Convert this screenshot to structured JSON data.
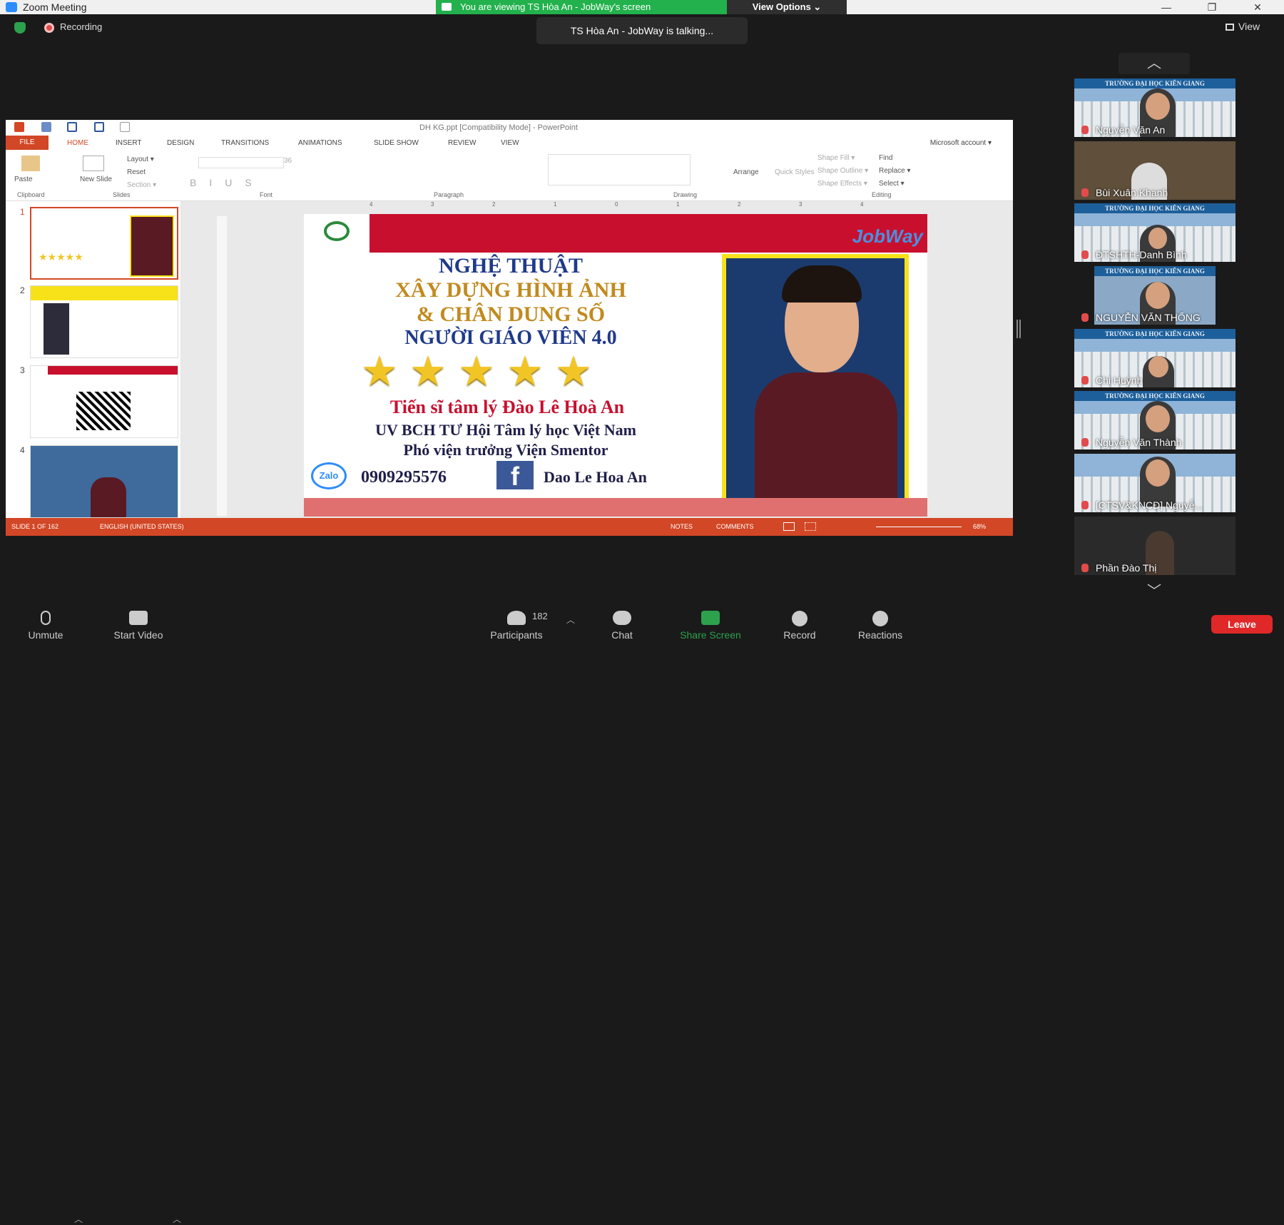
{
  "window": {
    "title": "Zoom Meeting",
    "minimize": "—",
    "maximize": "❐",
    "close": "✕"
  },
  "banner": {
    "viewing": "You are viewing TS Hòa An - JobWay's screen",
    "view_options": "View Options ⌄"
  },
  "recording": "Recording",
  "talking": "TS Hòa An - JobWay is talking...",
  "view_label": "View",
  "gallery": [
    {
      "name": "Nguyễn Văn An",
      "banner": "TRƯỜNG ĐẠI HỌC KIÊN GIANG"
    },
    {
      "name": "Bùi Xuân Khanh",
      "banner": ""
    },
    {
      "name": "ĐTSHTH-Danh Bình",
      "banner": "TRƯỜNG ĐẠI HỌC KIÊN GIANG"
    },
    {
      "name": "NGUYỄN VĂN THỐNG",
      "banner": "TRƯỜNG ĐẠI HỌC KIÊN GIANG"
    },
    {
      "name": "Chi Huỳnh",
      "banner": "TRƯỜNG ĐẠI HỌC KIÊN GIANG"
    },
    {
      "name": "Nguyễn Văn Thành",
      "banner": "TRƯỜNG ĐẠI HỌC KIÊN GIANG"
    },
    {
      "name": "[CTSV&KNCĐ] Nguyễ...",
      "banner": ""
    },
    {
      "name": "Phần Đào Thị",
      "banner": ""
    }
  ],
  "powerpoint": {
    "title": "DH KG.ppt [Compatibility Mode] - PowerPoint",
    "file_tab": "FILE",
    "tabs": [
      "HOME",
      "INSERT",
      "DESIGN",
      "TRANSITIONS",
      "ANIMATIONS",
      "SLIDE SHOW",
      "REVIEW",
      "VIEW"
    ],
    "account": "Microsoft account ▾",
    "ribbon": {
      "paste": "Paste",
      "new_slide": "New Slide",
      "layout": "Layout ▾",
      "reset": "Reset",
      "section": "Section ▾",
      "arrange": "Arrange",
      "quick_styles": "Quick Styles",
      "shape_fill": "Shape Fill ▾",
      "shape_outline": "Shape Outline ▾",
      "shape_effects": "Shape Effects ▾",
      "find": "Find",
      "replace": "Replace ▾",
      "select": "Select ▾",
      "font_size": "36",
      "groups": [
        "Clipboard",
        "Slides",
        "Font",
        "Paragraph",
        "Drawing",
        "Editing"
      ]
    },
    "thumb_numbers": [
      "1",
      "2",
      "3",
      "4"
    ],
    "ruler": [
      "4",
      "3",
      "2",
      "1",
      "0",
      "1",
      "2",
      "3",
      "4"
    ],
    "slide": {
      "line1": "NGHỆ THUẬT",
      "line2": "XÂY DỰNG HÌNH ẢNH",
      "line3": "& CHÂN DUNG SỐ",
      "line4": "NGƯỜI GIÁO VIÊN 4.0",
      "stars": "★★★★★",
      "doctor": "Tiến sĩ tâm lý Đào Lê Hoà An",
      "uvbch": "UV BCH TƯ Hội Tâm lý học Việt Nam",
      "vice": "Phó viện trưởng Viện Smentor",
      "zalo": "Zalo",
      "phone": "0909295576",
      "fb_letter": "f",
      "fb_name": "Dao Le Hoa An",
      "jobway": "JobWay"
    },
    "status": {
      "slide": "SLIDE 1 OF 162",
      "language": "ENGLISH (UNITED STATES)",
      "notes": "NOTES",
      "comments": "COMMENTS",
      "zoom": "68%"
    }
  },
  "toolbar": {
    "unmute": "Unmute",
    "start_video": "Start Video",
    "participants": "Participants",
    "participant_count": "182",
    "chat": "Chat",
    "share": "Share Screen",
    "record": "Record",
    "reactions": "Reactions",
    "leave": "Leave"
  }
}
